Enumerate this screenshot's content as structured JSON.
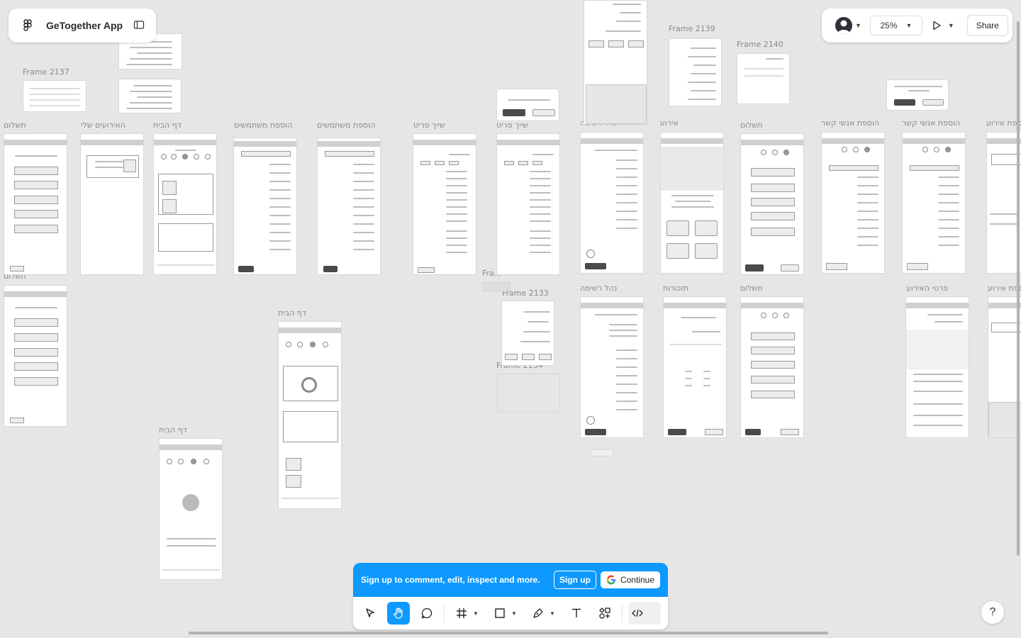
{
  "file": {
    "name": "GeTogether App"
  },
  "controls": {
    "zoom": "25%",
    "share": "Share"
  },
  "banner": {
    "text": "Sign up to comment, edit, inspect and more.",
    "signup": "Sign up",
    "continue": "Continue"
  },
  "help": "?",
  "labels": {
    "payment": "תשלום",
    "my_events": "האירועים שלי",
    "home": "דף הבית",
    "add_users": "הוספת משתמשים",
    "assign_item": "שייך פריט",
    "manage_list": "נהל רשימה",
    "event": "אירוע",
    "add_contacts": "הוספת אנשי קשר",
    "add_event": "הוספת אירוע",
    "reminders": "תזכורות",
    "event_details": "פרטי האירוע",
    "frame_2137": "Frame 2137",
    "frame_2139": "Frame 2139",
    "frame_2140": "Frame 2140",
    "frame_2133": "Frame 2133",
    "frame_2134": "Frame 2134",
    "fra": "Fra..."
  }
}
